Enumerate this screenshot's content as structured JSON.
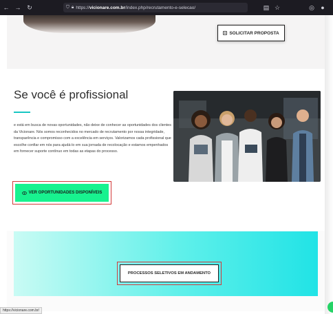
{
  "browser": {
    "url_prefix": "https://",
    "url_host": "vicionare.com.br",
    "url_path": "/index.php/recrutamento-e-selecao/",
    "icons": [
      "back-icon",
      "forward-icon",
      "reload-icon",
      "shield-icon",
      "lock-icon",
      "reader-icon",
      "star-icon",
      "pocket-icon",
      "account-icon"
    ]
  },
  "hero": {
    "solicitar_label": "SOLICITAR PROPOSTA"
  },
  "profissional": {
    "title": "Se você é profissional",
    "body": "e está em busca de novas oportunidades, não deixe de conhecer as oportunidades dos clientes da Vicionare. Nós somos reconhecidos no mercado de recrutamento por nossa integridade, transparência e compromisso com a excelência em serviços. Valorizamos cada profissional que escolhe confiar em nós para ajudá-lo em sua jornada de recolocação e estamos empenhados em fornecer suporte contínuo em todas as etapas do processo.",
    "cta_label": "VER OPORTUNIDADES DISPONÍVEIS"
  },
  "processos": {
    "cta_label": "PROCESSOS SELETIVOS EM ANDAMENTO"
  },
  "status_bar": {
    "text": "https://vicionare.com.br/"
  },
  "colors": {
    "accent_teal": "#17c6c3",
    "green_button": "#18f28f",
    "highlight_red": "#d23a3a",
    "whatsapp": "#25d366"
  }
}
